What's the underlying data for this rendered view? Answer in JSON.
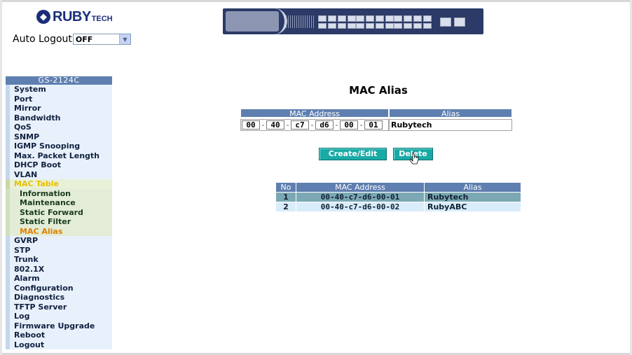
{
  "header": {
    "logo_text": "RUBY",
    "logo_sub": "TECH",
    "autologout_label": "Auto Logout",
    "autologout_value": "OFF"
  },
  "sidebar": {
    "title": "GS-2124C",
    "items": [
      {
        "label": "System"
      },
      {
        "label": "Port"
      },
      {
        "label": "Mirror"
      },
      {
        "label": "Bandwidth"
      },
      {
        "label": "QoS"
      },
      {
        "label": "SNMP"
      },
      {
        "label": "IGMP Snooping"
      },
      {
        "label": "Max. Packet Length"
      },
      {
        "label": "DHCP Boot"
      },
      {
        "label": "VLAN"
      },
      {
        "label": "MAC Table"
      },
      {
        "label": "GVRP"
      },
      {
        "label": "STP"
      },
      {
        "label": "Trunk"
      },
      {
        "label": "802.1X"
      },
      {
        "label": "Alarm"
      },
      {
        "label": "Configuration"
      },
      {
        "label": "Diagnostics"
      },
      {
        "label": "TFTP Server"
      },
      {
        "label": "Log"
      },
      {
        "label": "Firmware Upgrade"
      },
      {
        "label": "Reboot"
      },
      {
        "label": "Logout"
      }
    ],
    "mac_table_sub": [
      {
        "label": "Information"
      },
      {
        "label": "Maintenance"
      },
      {
        "label": "Static Forward"
      },
      {
        "label": "Static Filter"
      },
      {
        "label": "MAC Alias"
      }
    ],
    "active_item": "MAC Table",
    "active_sub": "MAC Alias"
  },
  "main": {
    "title": "MAC Alias",
    "form": {
      "mac_header": "MAC Address",
      "alias_header": "Alias",
      "octets": [
        "00",
        "40",
        "c7",
        "d6",
        "00",
        "01"
      ],
      "alias_value": "Rubytech"
    },
    "buttons": {
      "create": "Create/Edit",
      "delete": "Delete"
    },
    "table": {
      "headers": [
        "No",
        "MAC Address",
        "Alias"
      ],
      "rows": [
        {
          "no": "1",
          "mac": "00-40-c7-d6-00-01",
          "alias": "Rubytech"
        },
        {
          "no": "2",
          "mac": "00-40-c7-d6-00-02",
          "alias": "RubyABC"
        }
      ]
    }
  },
  "colors": {
    "header_blue": "#5f7fb0",
    "button_teal": "#1aaaa6",
    "active_yellow": "#e8c000",
    "active_orange": "#e08000"
  }
}
